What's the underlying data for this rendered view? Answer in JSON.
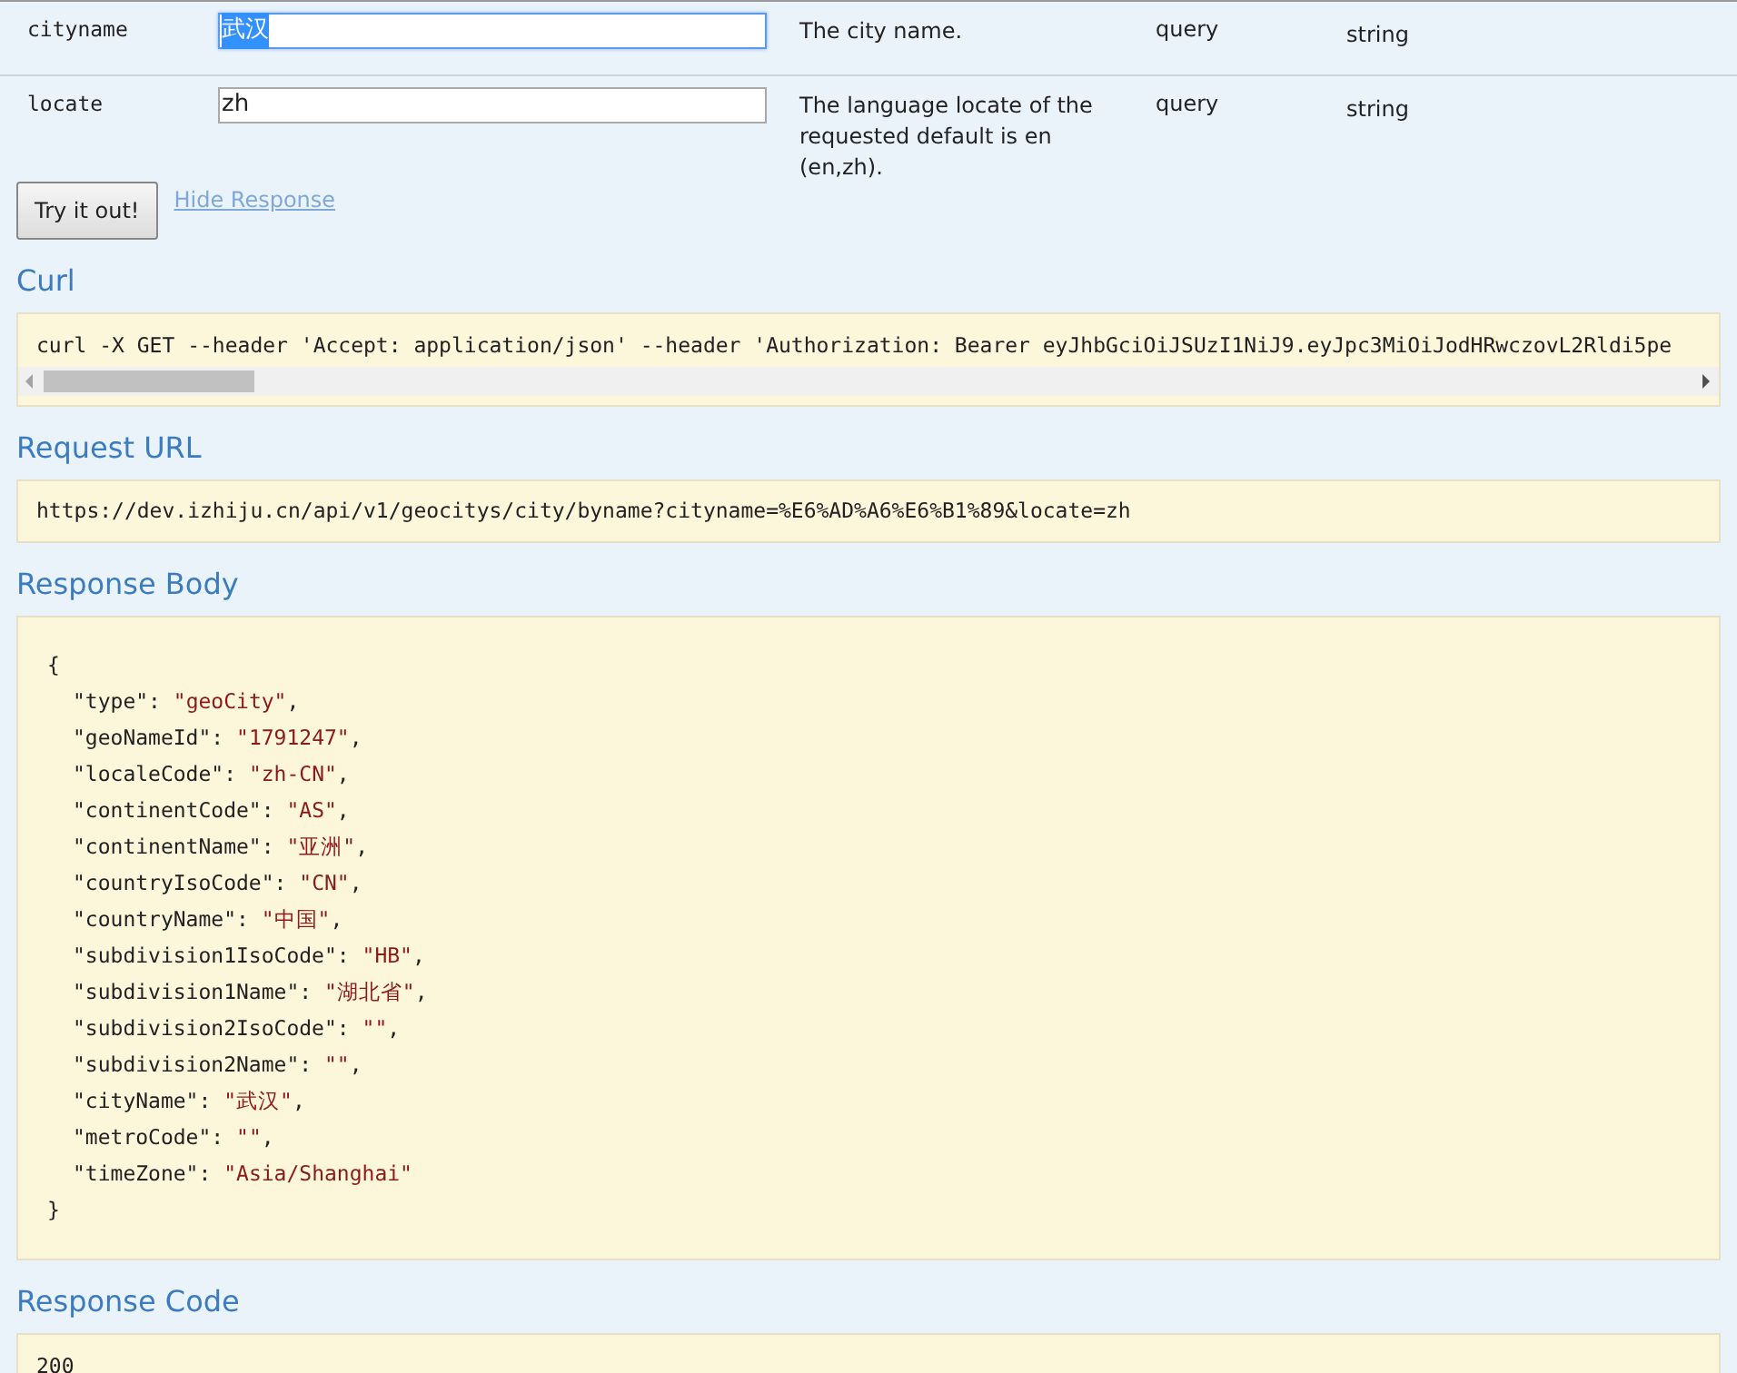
{
  "parameters": [
    {
      "name": "cityname",
      "value": "武汉",
      "focused": true,
      "description": "The city name.",
      "param_type": "query",
      "data_type": "string"
    },
    {
      "name": "locate",
      "value": "zh",
      "focused": false,
      "description": "The language locate of the requested default is en (en,zh).",
      "param_type": "query",
      "data_type": "string"
    }
  ],
  "try_button": "Try it out!",
  "hide_link": "Hide Response",
  "curl": {
    "heading": "Curl",
    "command": "curl -X GET --header 'Accept: application/json' --header 'Authorization: Bearer eyJhbGciOiJSUzI1NiJ9.eyJpc3MiOiJodHRwczovL2Rldi5pe"
  },
  "request_url": {
    "heading": "Request URL",
    "url": "https://dev.izhiju.cn/api/v1/geocitys/city/byname?cityname=%E6%AD%A6%E6%B1%89&locate=zh"
  },
  "response_body": {
    "heading": "Response Body",
    "open": "{",
    "close": "}",
    "lines": [
      {
        "key": "\"type\":",
        "value": "\"geoCity\"",
        "punct": ","
      },
      {
        "key": "\"geoNameId\":",
        "value": "\"1791247\"",
        "punct": ","
      },
      {
        "key": "\"localeCode\":",
        "value": "\"zh-CN\"",
        "punct": ","
      },
      {
        "key": "\"continentCode\":",
        "value": "\"AS\"",
        "punct": ","
      },
      {
        "key": "\"continentName\":",
        "value": "\"亚洲\"",
        "punct": ","
      },
      {
        "key": "\"countryIsoCode\":",
        "value": "\"CN\"",
        "punct": ","
      },
      {
        "key": "\"countryName\":",
        "value": "\"中国\"",
        "punct": ","
      },
      {
        "key": "\"subdivision1IsoCode\":",
        "value": "\"HB\"",
        "punct": ","
      },
      {
        "key": "\"subdivision1Name\":",
        "value": "\"湖北省\"",
        "punct": ","
      },
      {
        "key": "\"subdivision2IsoCode\":",
        "value": "\"\"",
        "punct": ","
      },
      {
        "key": "\"subdivision2Name\":",
        "value": "\"\"",
        "punct": ","
      },
      {
        "key": "\"cityName\":",
        "value": "\"武汉\"",
        "punct": ","
      },
      {
        "key": "\"metroCode\":",
        "value": "\"\"",
        "punct": ","
      },
      {
        "key": "\"timeZone\":",
        "value": "\"Asia/Shanghai\""
      }
    ]
  },
  "response_code": {
    "heading": "Response Code",
    "code": "200"
  }
}
